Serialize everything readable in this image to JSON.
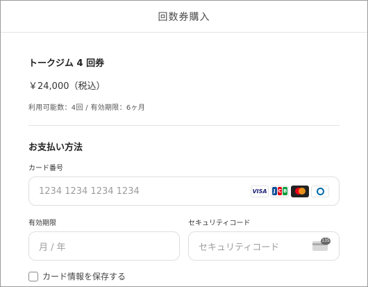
{
  "header": {
    "title": "回数券購入"
  },
  "product": {
    "name": "トークジム 4 回券",
    "price": "￥24,000（税込）",
    "details": "利用可能数：4回 / 有効期限：6ヶ月"
  },
  "payment": {
    "section_title": "お支払い方法",
    "card_number": {
      "label": "カード番号",
      "placeholder": "1234 1234 1234 1234"
    },
    "brands": {
      "visa": "VISA",
      "jcb": [
        "J",
        "C",
        "B"
      ],
      "mastercard_icon": "mastercard-icon",
      "diners_icon": "diners-club-icon"
    },
    "expiry": {
      "label": "有効期限",
      "placeholder": "月 / 年"
    },
    "security_code": {
      "label": "セキュリティコード",
      "placeholder": "セキュリティコード",
      "icon_number": "135"
    },
    "save_card": {
      "label": "カード情報を保存する",
      "checked": false
    }
  },
  "colors": {
    "jcb_blue": "#0e4c96",
    "jcb_red": "#e60012",
    "jcb_green": "#009e3c",
    "visa_blue": "#1a1f71"
  }
}
